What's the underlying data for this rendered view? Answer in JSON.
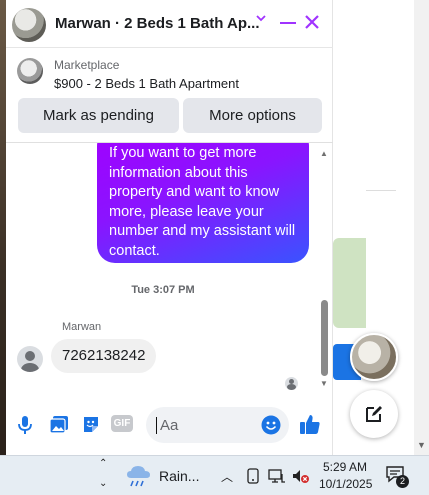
{
  "chat": {
    "title": "Marwan · 2 Beds 1 Bath Ap...",
    "colors": {
      "accent": "#a033ff",
      "bubble_gradient_start": "#a100ff",
      "bubble_gradient_end": "#3a53ff"
    }
  },
  "listing": {
    "category": "Marketplace",
    "title": "$900 - 2 Beds 1 Bath Apartment",
    "buttons": {
      "pending": "Mark as pending",
      "more": "More options"
    }
  },
  "messages": {
    "outgoing_text": "If you want to get more information about this property and want to know more, please leave your number and my assistant will contact.",
    "timestamp": "Tue 3:07 PM",
    "sender_name": "Marwan",
    "incoming_text": "7262138242"
  },
  "composer": {
    "placeholder": "Aa",
    "gif_label": "GIF",
    "icons": [
      "microphone-icon",
      "gallery-icon",
      "sticker-icon",
      "gif-icon",
      "emoji-icon",
      "like-icon"
    ]
  },
  "taskbar": {
    "weather": "Rain...",
    "time": "5:29 AM",
    "date": "10/1/2025",
    "notification_count": "2"
  }
}
